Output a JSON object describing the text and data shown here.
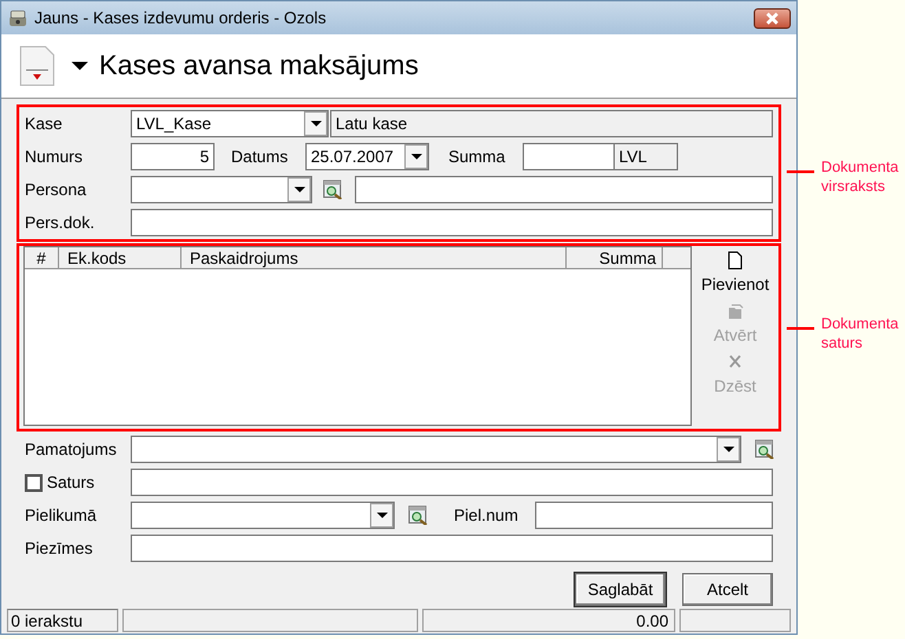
{
  "window": {
    "title": "Jauns - Kases izdevumu orderis - Ozols"
  },
  "header": {
    "title": "Kases avansa maksājums"
  },
  "document_header": {
    "kase": {
      "label": "Kase",
      "value": "LVL_Kase",
      "description": "Latu kase"
    },
    "numurs": {
      "label": "Numurs",
      "value": "5"
    },
    "datums": {
      "label": "Datums",
      "value": "25.07.2007"
    },
    "summa": {
      "label": "Summa",
      "currency": "LVL"
    },
    "persona": {
      "label": "Persona"
    },
    "pers_dok": {
      "label": "Pers.dok."
    }
  },
  "lines_table": {
    "columns": [
      "#",
      "Ek.kods",
      "Paskaidrojums",
      "Summa"
    ]
  },
  "line_actions": [
    {
      "label": "Pievienot",
      "disabled": false,
      "kind": "add"
    },
    {
      "label": "Atvērt",
      "disabled": true,
      "kind": "open"
    },
    {
      "label": "Dzēst",
      "disabled": true,
      "kind": "delete"
    }
  ],
  "footer_fields": {
    "pamatojums": {
      "label": "Pamatojums"
    },
    "saturs": {
      "label": "Saturs",
      "checked": false
    },
    "pielikuma": {
      "label": "Pielikumā"
    },
    "piel_num": {
      "label": "Piel.num"
    },
    "piezimes": {
      "label": "Piezīmes"
    }
  },
  "buttons": [
    "Saglabāt",
    "Atcelt"
  ],
  "status_bar": {
    "record_count": "0 ierakstu",
    "total": "0.00"
  },
  "annotations": [
    "Dokumenta virsraksts",
    "Dokumenta saturs"
  ]
}
